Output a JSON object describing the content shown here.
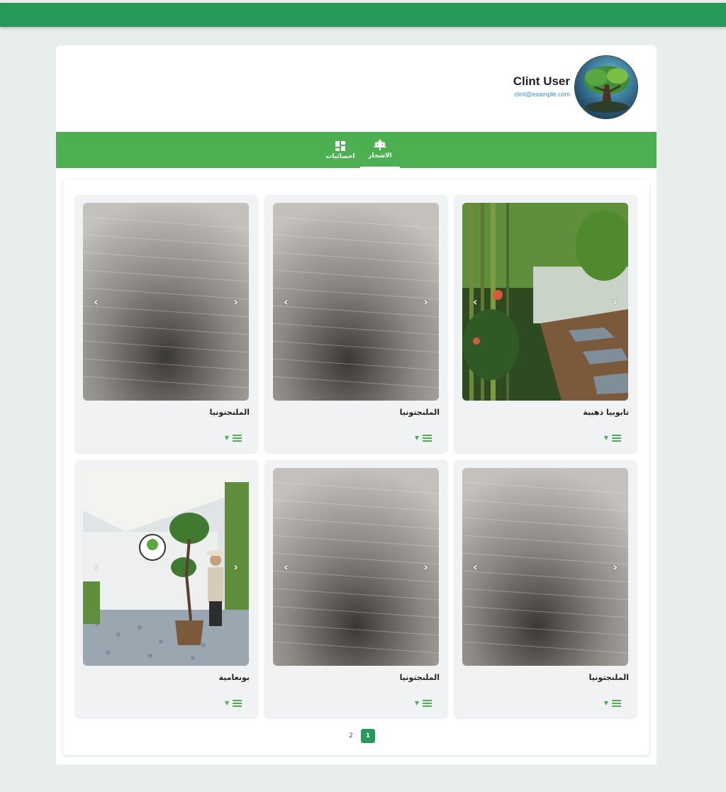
{
  "profile": {
    "name": "Clint User",
    "email": "clint@example.com"
  },
  "nav": {
    "tabs": [
      {
        "label": "الاشجار",
        "icon": "tree-icon",
        "active": true
      },
      {
        "label": "احصائيات",
        "icon": "dashboard-icon",
        "active": false
      }
    ]
  },
  "cards": [
    {
      "title": "تابوبيا ذهبية",
      "image": "garden-photo"
    },
    {
      "title": "الملنجتونيا",
      "image": "placeholder-texture"
    },
    {
      "title": "الملنجتونيا",
      "image": "placeholder-texture"
    },
    {
      "title": "الملنجتونيا",
      "image": "placeholder-texture"
    },
    {
      "title": "الملنجتونيا",
      "image": "placeholder-texture"
    },
    {
      "title": "بونغامية",
      "image": "man-with-tree-photo"
    }
  ],
  "pagination": {
    "pages": [
      "1",
      "2"
    ],
    "current": "1"
  },
  "colors": {
    "topbar": "#27995a",
    "nav": "#4caf50",
    "accent": "#27995a"
  }
}
